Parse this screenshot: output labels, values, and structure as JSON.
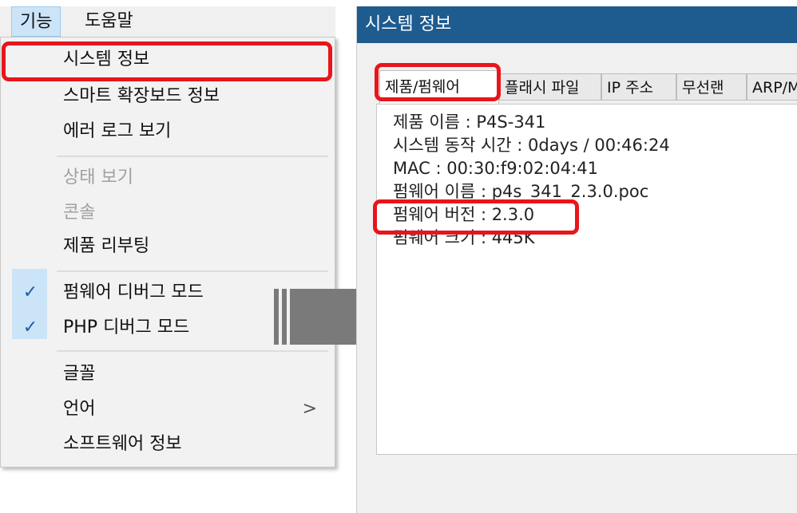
{
  "menubar": {
    "items": [
      "기능",
      "도움말"
    ]
  },
  "menu": {
    "items": [
      {
        "label": "시스템 정보"
      },
      {
        "label": "스마트 확장보드 정보"
      },
      {
        "label": "에러 로그 보기"
      },
      {
        "label": "상태 보기"
      },
      {
        "label": "콘솔"
      },
      {
        "label": "제품 리부팅"
      },
      {
        "label": "펌웨어 디버그 모드"
      },
      {
        "label": "PHP 디버그 모드"
      },
      {
        "label": "글꼴"
      },
      {
        "label": "언어"
      },
      {
        "label": "소프트웨어 정보"
      }
    ],
    "checked": [
      "펌웨어 디버그 모드",
      "PHP 디버그 모드"
    ],
    "submenu_arrow": ">",
    "check_glyph": "✓"
  },
  "window": {
    "title": "시스템 정보",
    "tabs": [
      "제품/펌웨어",
      "플래시 파일",
      "IP 주소",
      "무선랜",
      "ARP/M"
    ],
    "info": [
      "제품 이름 : P4S-341",
      "시스템 동작 시간 : 0days / 00:46:24",
      "MAC : 00:30:f9:02:04:41",
      "펌웨어 이름 : p4s_341_2.3.0.poc",
      "펌웨어 버전 : 2.3.0",
      "펌웨어 크기 : 445K"
    ]
  },
  "colors": {
    "highlight": "#e8151b",
    "title_bar": "#1e5b8f",
    "check_strip": "#cce4f7",
    "arrow": "#7a7a7a"
  }
}
